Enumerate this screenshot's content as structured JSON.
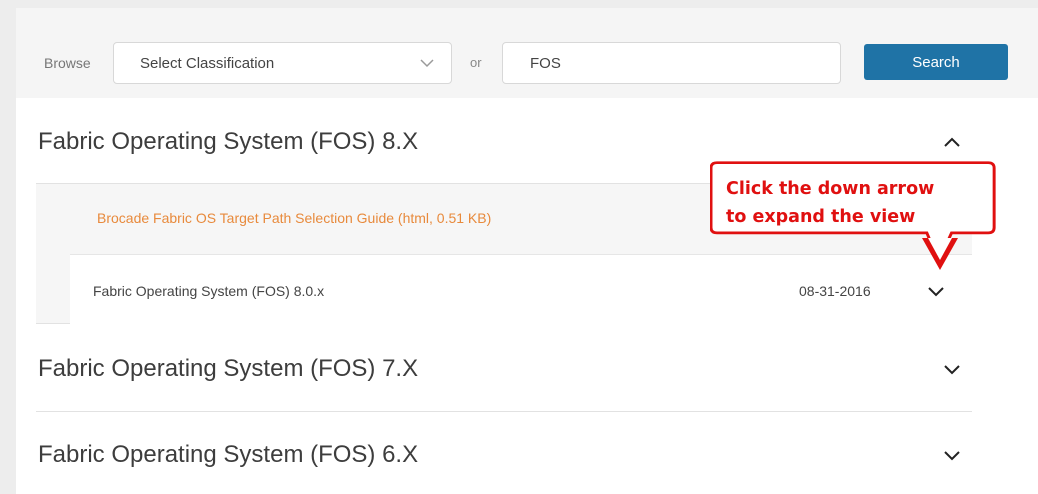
{
  "search": {
    "browse_label": "Browse",
    "classification_value": "Select Classification",
    "or_label": "or",
    "query_value": "FOS",
    "search_button": "Search"
  },
  "sections": [
    {
      "title": "Fabric Operating System (FOS) 8.X",
      "expanded": true,
      "guide_link": "Brocade Fabric OS Target Path Selection Guide (html, 0.51 KB)",
      "releases": [
        {
          "title": "Fabric Operating System (FOS) 8.0.x",
          "date": "08-31-2016"
        }
      ]
    },
    {
      "title": "Fabric Operating System (FOS) 7.X",
      "expanded": false
    },
    {
      "title": "Fabric Operating System (FOS) 6.X",
      "expanded": false
    }
  ],
  "callout": {
    "line1": "Click the down arrow",
    "line2": "to expand the view"
  },
  "colors": {
    "accent_blue": "#1f73a6",
    "link_orange": "#e88a3c",
    "callout_red": "#e01010"
  }
}
